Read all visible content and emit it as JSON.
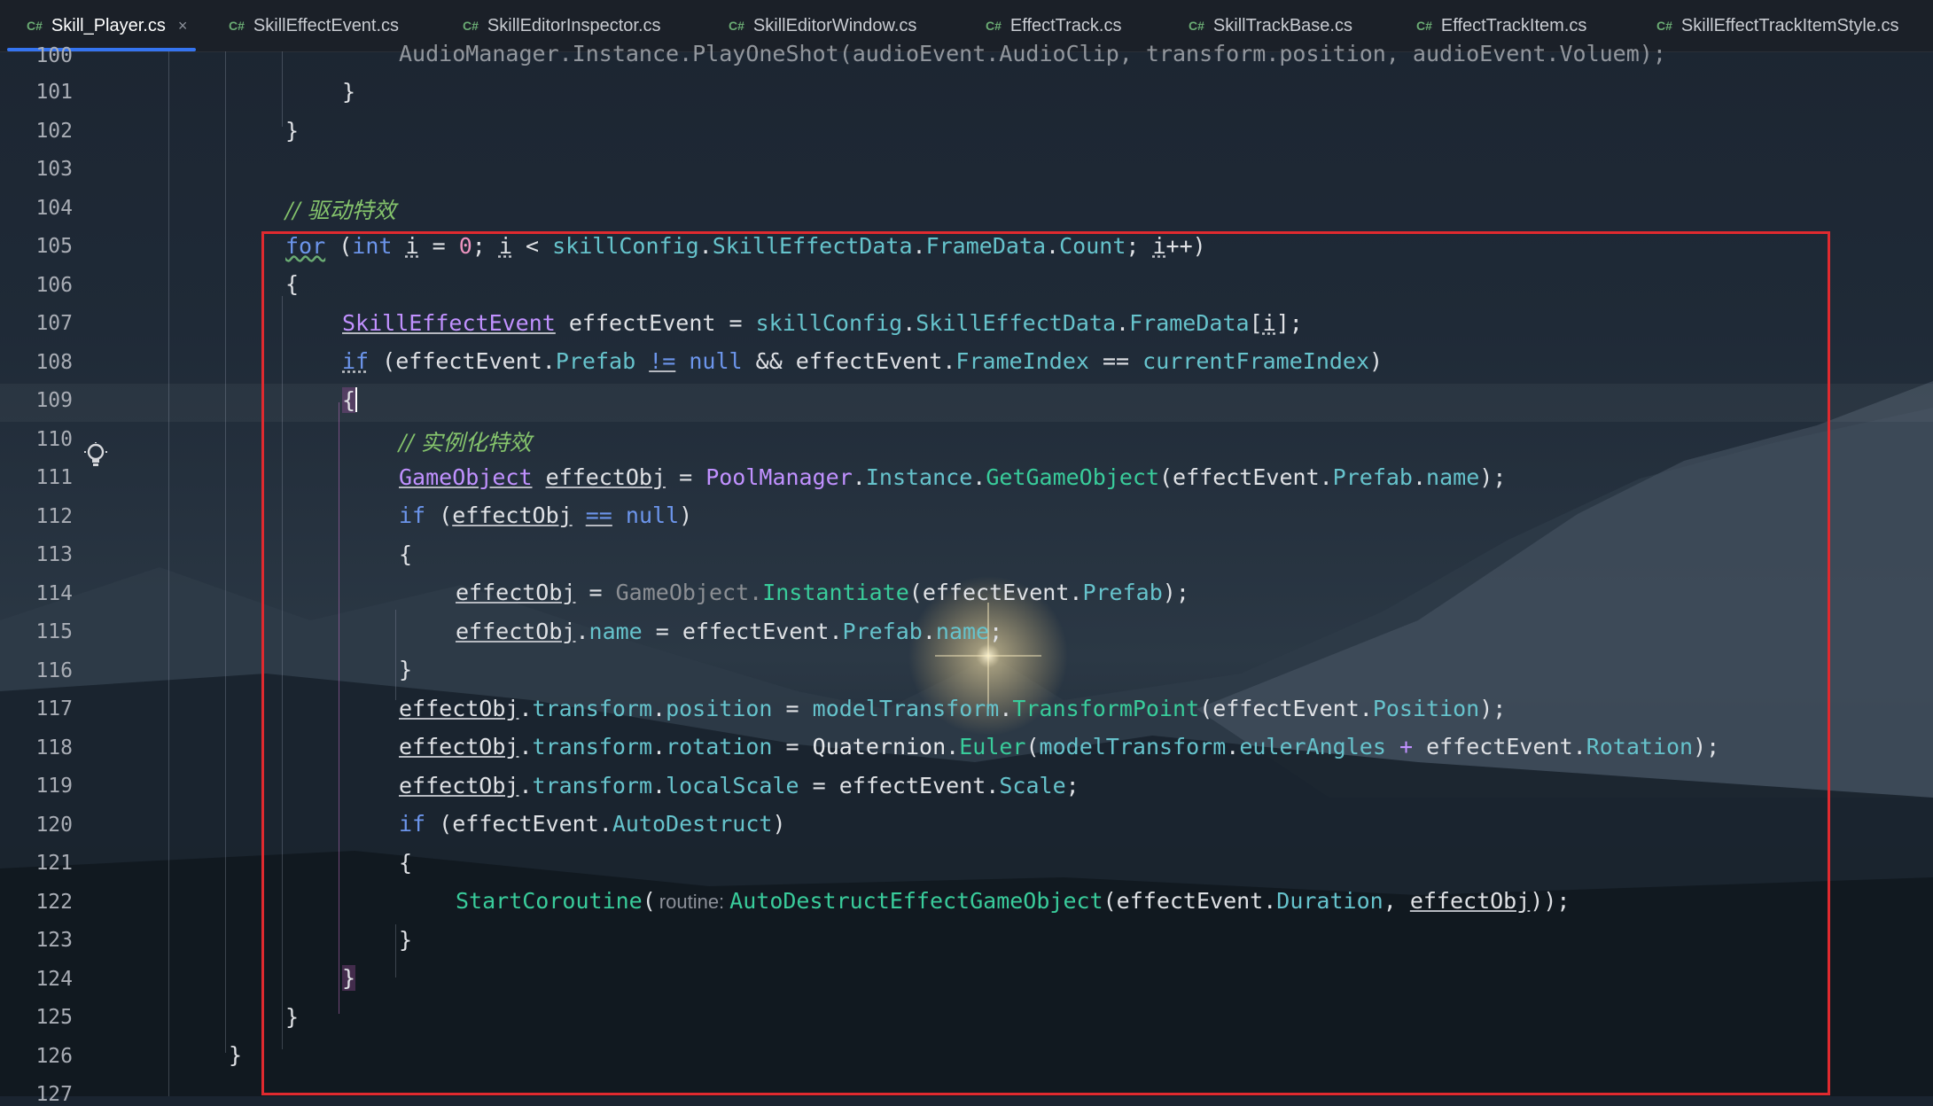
{
  "tabs": [
    {
      "badge": "C#",
      "label": "Skill_Player.cs",
      "active": true,
      "close": "×"
    },
    {
      "badge": "C#",
      "label": "SkillEffectEvent.cs"
    },
    {
      "badge": "C#",
      "label": "SkillEditorInspector.cs"
    },
    {
      "badge": "C#",
      "label": "SkillEditorWindow.cs"
    },
    {
      "badge": "C#",
      "label": "EffectTrack.cs"
    },
    {
      "badge": "C#",
      "label": "SkillTrackBase.cs"
    },
    {
      "badge": "C#",
      "label": "EffectTrackItem.cs"
    },
    {
      "badge": "C#",
      "label": "SkillEffectTrackItemStyle.cs"
    }
  ],
  "line_numbers": [
    "100",
    "101",
    "102",
    "103",
    "104",
    "105",
    "106",
    "107",
    "108",
    "109",
    "110",
    "111",
    "112",
    "113",
    "114",
    "115",
    "116",
    "117",
    "118",
    "119",
    "120",
    "121",
    "122",
    "123",
    "124",
    "125",
    "126",
    "127"
  ],
  "code": {
    "l100": "AudioManager.Instance.PlayOneShot(audioEvent.AudioClip, transform.position, audioEvent.Voluem);",
    "l101": "}",
    "l102": "}",
    "l104": "// 驱动特效",
    "l105": [
      "for",
      " (",
      "int",
      " ",
      "i",
      " = ",
      "0",
      "; ",
      "i",
      " < ",
      "skillConfig",
      ".",
      "SkillEffectData",
      ".",
      "FrameData",
      ".",
      "Count",
      "; ",
      "i",
      "++)"
    ],
    "l106": "{",
    "l107": [
      "SkillEffectEvent",
      " effectEvent = ",
      "skillConfig",
      ".",
      "SkillEffectData",
      ".",
      "FrameData",
      "[",
      "i",
      "];"
    ],
    "l108": [
      "if",
      " (effectEvent.",
      "Prefab",
      " ",
      "!=",
      " ",
      "null",
      " && effectEvent.",
      "FrameIndex",
      " == ",
      "currentFrameIndex",
      ")"
    ],
    "l109": "{",
    "l110": "// 实例化特效",
    "l111": [
      "GameObject",
      " ",
      "effectObj",
      " = ",
      "PoolManager",
      ".",
      "Instance",
      ".",
      "GetGameObject",
      "(effectEvent.",
      "Prefab",
      ".",
      "name",
      ");"
    ],
    "l112": [
      "if",
      " (",
      "effectObj",
      " ",
      "==",
      " ",
      "null",
      ")"
    ],
    "l113": "{",
    "l114": [
      "effectObj",
      " = ",
      "GameObject.",
      "Instantiate",
      "(effectEvent.",
      "Prefab",
      ");"
    ],
    "l115": [
      "effectObj",
      ".",
      "name",
      " = effectEvent.",
      "Prefab",
      ".",
      "name",
      ";"
    ],
    "l116": "}",
    "l117": [
      "effectObj",
      ".",
      "transform",
      ".",
      "position",
      " = ",
      "modelTransform",
      ".",
      "TransformPoint",
      "(effectEvent.",
      "Position",
      ");"
    ],
    "l118": [
      "effectObj",
      ".",
      "transform",
      ".",
      "rotation",
      " = ",
      "Quaternion",
      ".",
      "Euler",
      "(",
      "modelTransform",
      ".",
      "eulerAngles",
      " + ",
      "effectEvent.",
      "Rotation",
      ");"
    ],
    "l119": [
      "effectObj",
      ".",
      "transform",
      ".",
      "localScale",
      " = effectEvent.",
      "Scale",
      ";"
    ],
    "l120": [
      "if",
      " (effectEvent.",
      "AutoDestruct",
      ")"
    ],
    "l121": "{",
    "l122": [
      "StartCoroutine",
      "(",
      "routine:",
      "AutoDestructEffectGameObject",
      "(effectEvent.",
      "Duration",
      ", ",
      "effectObj",
      "));"
    ],
    "l123": "}",
    "l124": "}",
    "l125": "}",
    "l126": "}"
  },
  "colors": {
    "keyword": "#6c95eb",
    "type": "#c191ff",
    "method": "#39cc9b",
    "member": "#66c3cc",
    "number": "#ed94c0",
    "comment": "#85c46c",
    "annotation_box": "#e02a2f",
    "active_tab_underline": "#3574f0"
  },
  "icons": {
    "gutter": "lightbulb-icon"
  }
}
